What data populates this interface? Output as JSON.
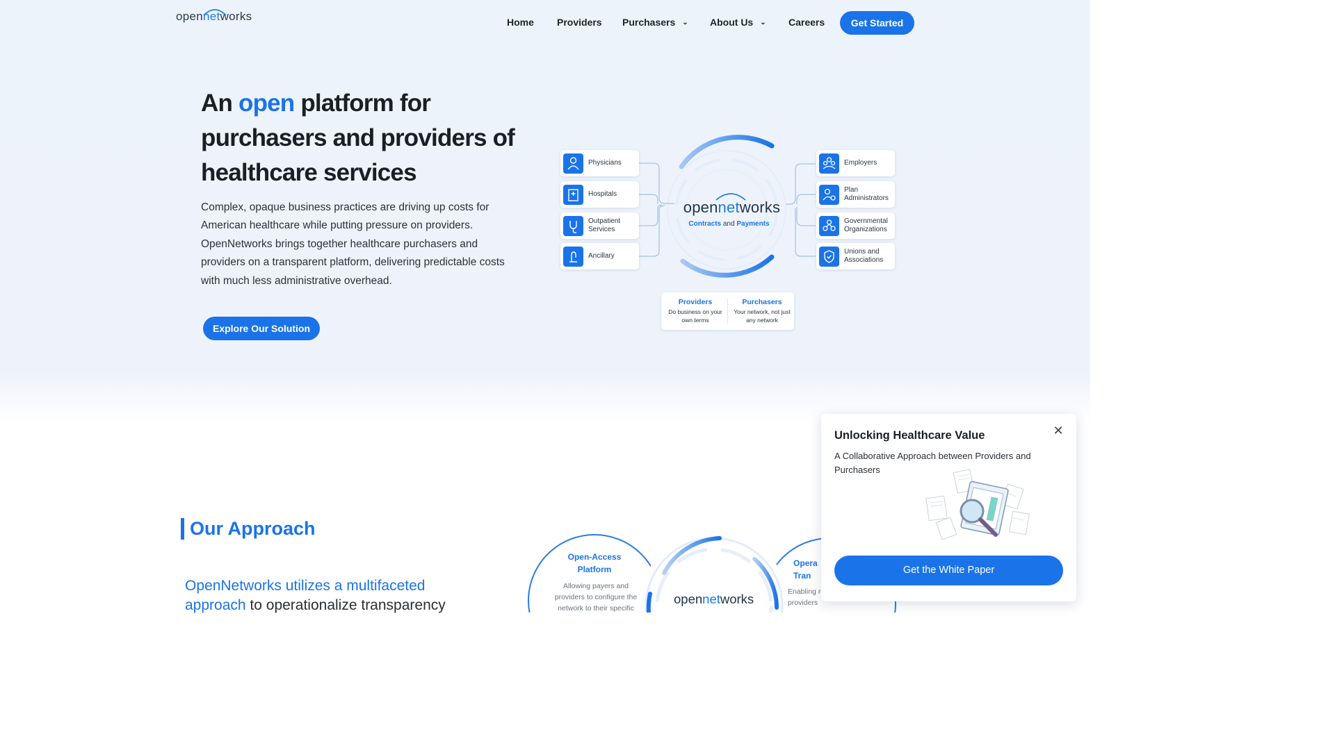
{
  "header": {
    "logo": {
      "part1": "open",
      "part2": "net",
      "part3": "works"
    },
    "nav": [
      {
        "label": "Home"
      },
      {
        "label": "Providers"
      },
      {
        "label": "Purchasers"
      },
      {
        "label": "About Us"
      },
      {
        "label": "Careers"
      }
    ],
    "cta_label": "Get Started"
  },
  "hero": {
    "title_part1": "An ",
    "title_accent": "open",
    "title_part2": " platform for purchasers and providers of healthcare services",
    "description": "Complex, opaque business practices are driving up costs for American healthcare while putting pressure on providers. OpenNetworks brings together healthcare purchasers and providers on a transparent platform, delivering predictable costs with much less administrative overhead.",
    "button_label": "Explore Our Solution"
  },
  "diagram": {
    "left_nodes": [
      "Physicians",
      "Hospitals",
      "Outpatient Services",
      "Ancillary"
    ],
    "right_nodes": [
      "Employers",
      "Plan Administrators",
      "Governmental Organizations",
      "Unions and Associations"
    ],
    "hub_logo": {
      "part1": "open",
      "part2": "net",
      "part3": "works"
    },
    "hub_sub": {
      "a": "Contracts",
      "and": " and ",
      "b": "Payments"
    },
    "legend": {
      "providers_title": "Providers",
      "providers_text": "Do business on your own terms",
      "purchasers_title": "Purchasers",
      "purchasers_text": "Your network, not just any network"
    }
  },
  "approach": {
    "title": "Our Approach",
    "text_highlight": "OpenNetworks utilizes a multifaceted approach",
    "text_rest": " to operationalize transparency",
    "circle1_title": "Open-Access Platform",
    "circle1_text": "Allowing payers and providers to configure the network to their specific",
    "circle2_logo": {
      "part1": "open",
      "part2": "net",
      "part3": "works"
    },
    "circle3_title": "Opera Tran",
    "circle3_text": "Enabling real costs and providers"
  },
  "popup": {
    "title": "Unlocking Healthcare Value",
    "subtitle": "A Collaborative Approach between Providers and Purchasers",
    "button_label": "Get the White Paper",
    "close_glyph": "✕"
  },
  "colors": {
    "accent": "#1a73e8",
    "hero_bg": "#edf3fb",
    "text": "#1f2328"
  }
}
